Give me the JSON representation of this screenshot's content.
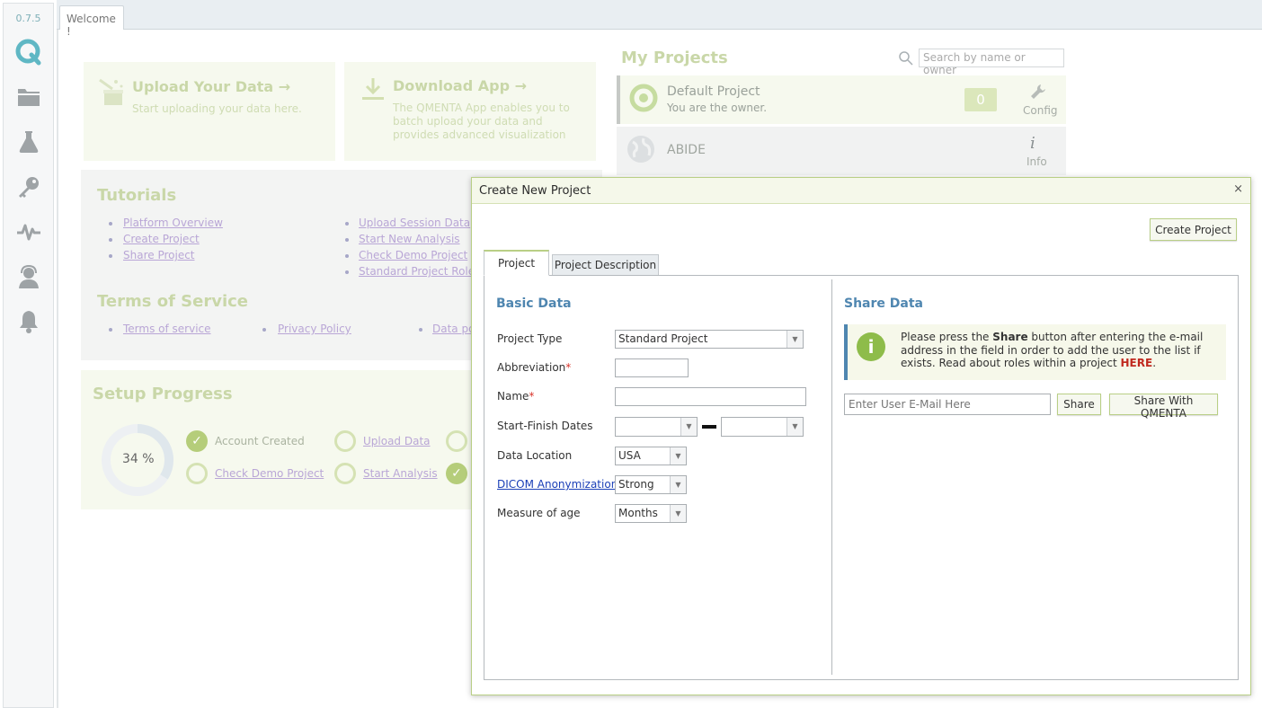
{
  "app": {
    "version": "0.7.5",
    "welcome_tab": "Welcome !"
  },
  "colors": {
    "accent_green": "#b9cf86",
    "heading_blue": "#4f86b0",
    "required_red": "#d9342b"
  },
  "sidebar": {
    "icons": [
      "qmenta-logo-icon",
      "folder-icon",
      "flask-icon",
      "key-icon",
      "pulse-icon",
      "support-agent-icon",
      "bell-icon"
    ]
  },
  "dashboard": {
    "upload": {
      "title": "Upload Your Data →",
      "text": "Start uploading your data here."
    },
    "download": {
      "title": "Download App →",
      "text_lines": [
        "The QMENTA App enables you to",
        "batch upload your data and",
        "provides advanced visualization"
      ]
    },
    "tutorials": {
      "title": "Tutorials",
      "col1": [
        "Platform Overview",
        "Create Project",
        "Share Project"
      ],
      "col2": [
        "Upload Session Data",
        "Start New Analysis",
        "Check Demo Project",
        "Standard Project Roles"
      ]
    },
    "terms": {
      "title": "Terms of Service",
      "links": [
        "Terms of service",
        "Privacy Policy",
        "Data po"
      ]
    },
    "setup": {
      "title": "Setup Progress",
      "percent": "34 %",
      "progress_fraction": 0.34,
      "items": [
        "Account Created",
        "Upload Data",
        "Check Demo Project",
        "Start Analysis"
      ]
    },
    "projects": {
      "title": "My Projects",
      "search_placeholder": "Search by name or owner",
      "list": [
        {
          "name": "Default Project",
          "sub": "You are the owner.",
          "count": "0",
          "action": "Config"
        },
        {
          "name": "ABIDE",
          "sub": "",
          "action": "Info"
        }
      ]
    }
  },
  "dialog": {
    "title": "Create New Project",
    "close": "×",
    "create_button": "Create Project",
    "tabs": [
      "Project",
      "Project Description"
    ],
    "basic": {
      "heading": "Basic Data",
      "project_type_label": "Project Type",
      "project_type_value": "Standard Project",
      "abbreviation_label": "Abbreviation",
      "name_label": "Name",
      "required_mark": "*",
      "dates_label": "Start-Finish Dates",
      "location_label": "Data Location",
      "location_value": "USA",
      "dicom_label": "DICOM Anonymization",
      "dicom_value": "Strong",
      "age_label": "Measure of age",
      "age_value": "Months"
    },
    "share": {
      "heading": "Share Data",
      "info_pre": "Please press the ",
      "info_bold": "Share",
      "info_mid": " button after entering the e-mail address in the field in order to add the user to the list if exists. Read about roles within a project ",
      "info_link": "HERE",
      "info_end": ".",
      "email_placeholder": "Enter User E-Mail Here",
      "share_button": "Share",
      "share_qmenta_button": "Share With QMENTA"
    }
  }
}
